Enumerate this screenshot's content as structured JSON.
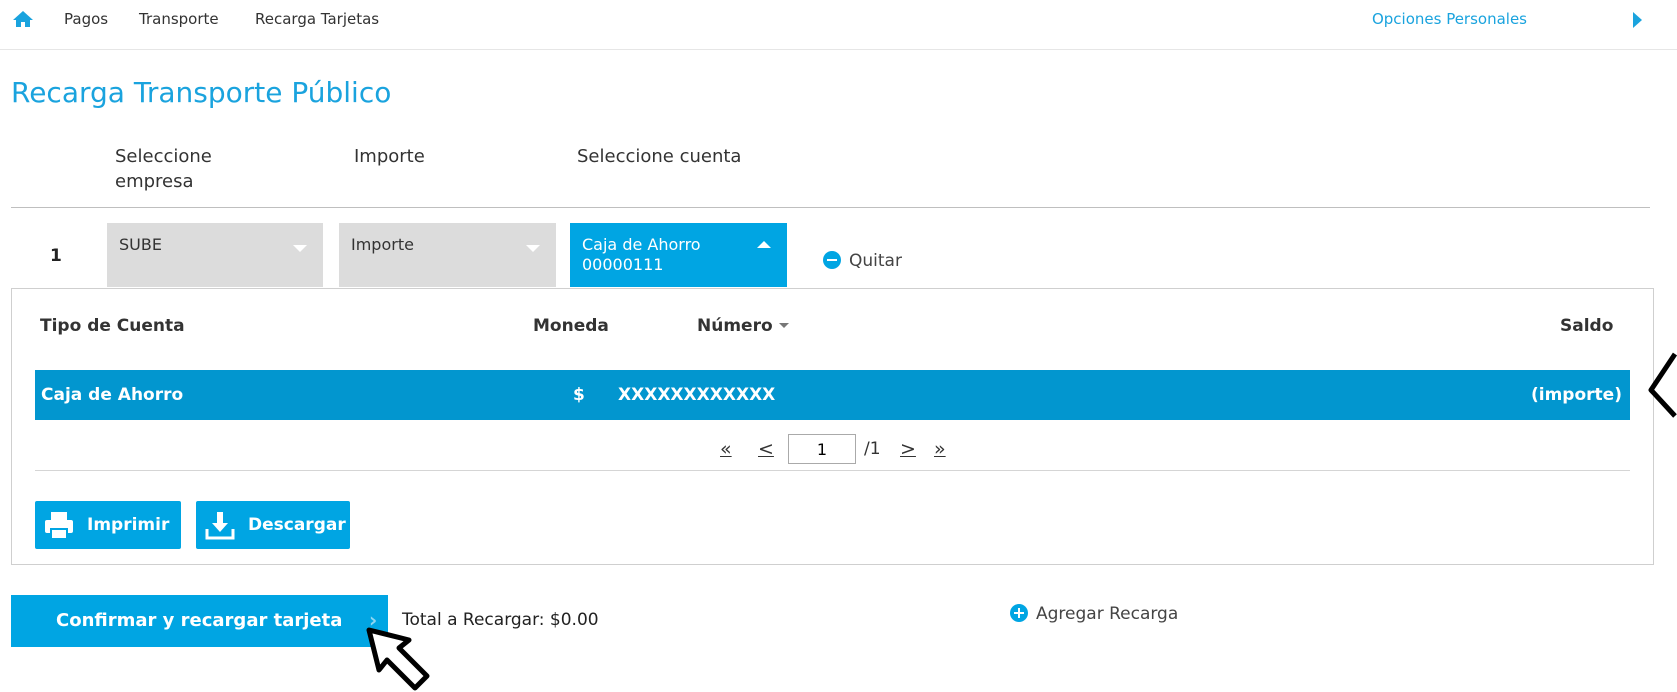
{
  "nav": {
    "links": [
      "Pagos",
      "Transporte",
      "Recarga Tarjetas"
    ],
    "personal": "Opciones Personales"
  },
  "page": {
    "title": "Recarga Transporte Público"
  },
  "columns": {
    "empresa": "Seleccione empresa",
    "importe": "Importe",
    "cuenta": "Seleccione cuenta"
  },
  "row": {
    "number": "1",
    "empresa_value": "SUBE",
    "importe_value": "Importe",
    "cuenta_type": "Caja de Ahorro",
    "cuenta_number": "00000111",
    "remove_label": "Quitar"
  },
  "accounts_table": {
    "headers": {
      "tipo": "Tipo de Cuenta",
      "moneda": "Moneda",
      "numero": "Número",
      "saldo": "Saldo"
    },
    "rows": [
      {
        "tipo": "Caja de Ahorro",
        "moneda": "$",
        "numero": "XXXXXXXXXXXX",
        "saldo": "(importe)"
      }
    ],
    "pagination": {
      "current": "1",
      "total": "/1",
      "first": "«",
      "prev": "<",
      "next": ">",
      "last": "»"
    }
  },
  "actions": {
    "print": "Imprimir",
    "download": "Descargar"
  },
  "footer": {
    "confirm": "Confirmar y recargar tarjeta",
    "total": "Total a Recargar: $0.00",
    "add": "Agregar Recarga"
  },
  "colors": {
    "accent": "#00a5e3",
    "selected_row": "#0296cf"
  }
}
